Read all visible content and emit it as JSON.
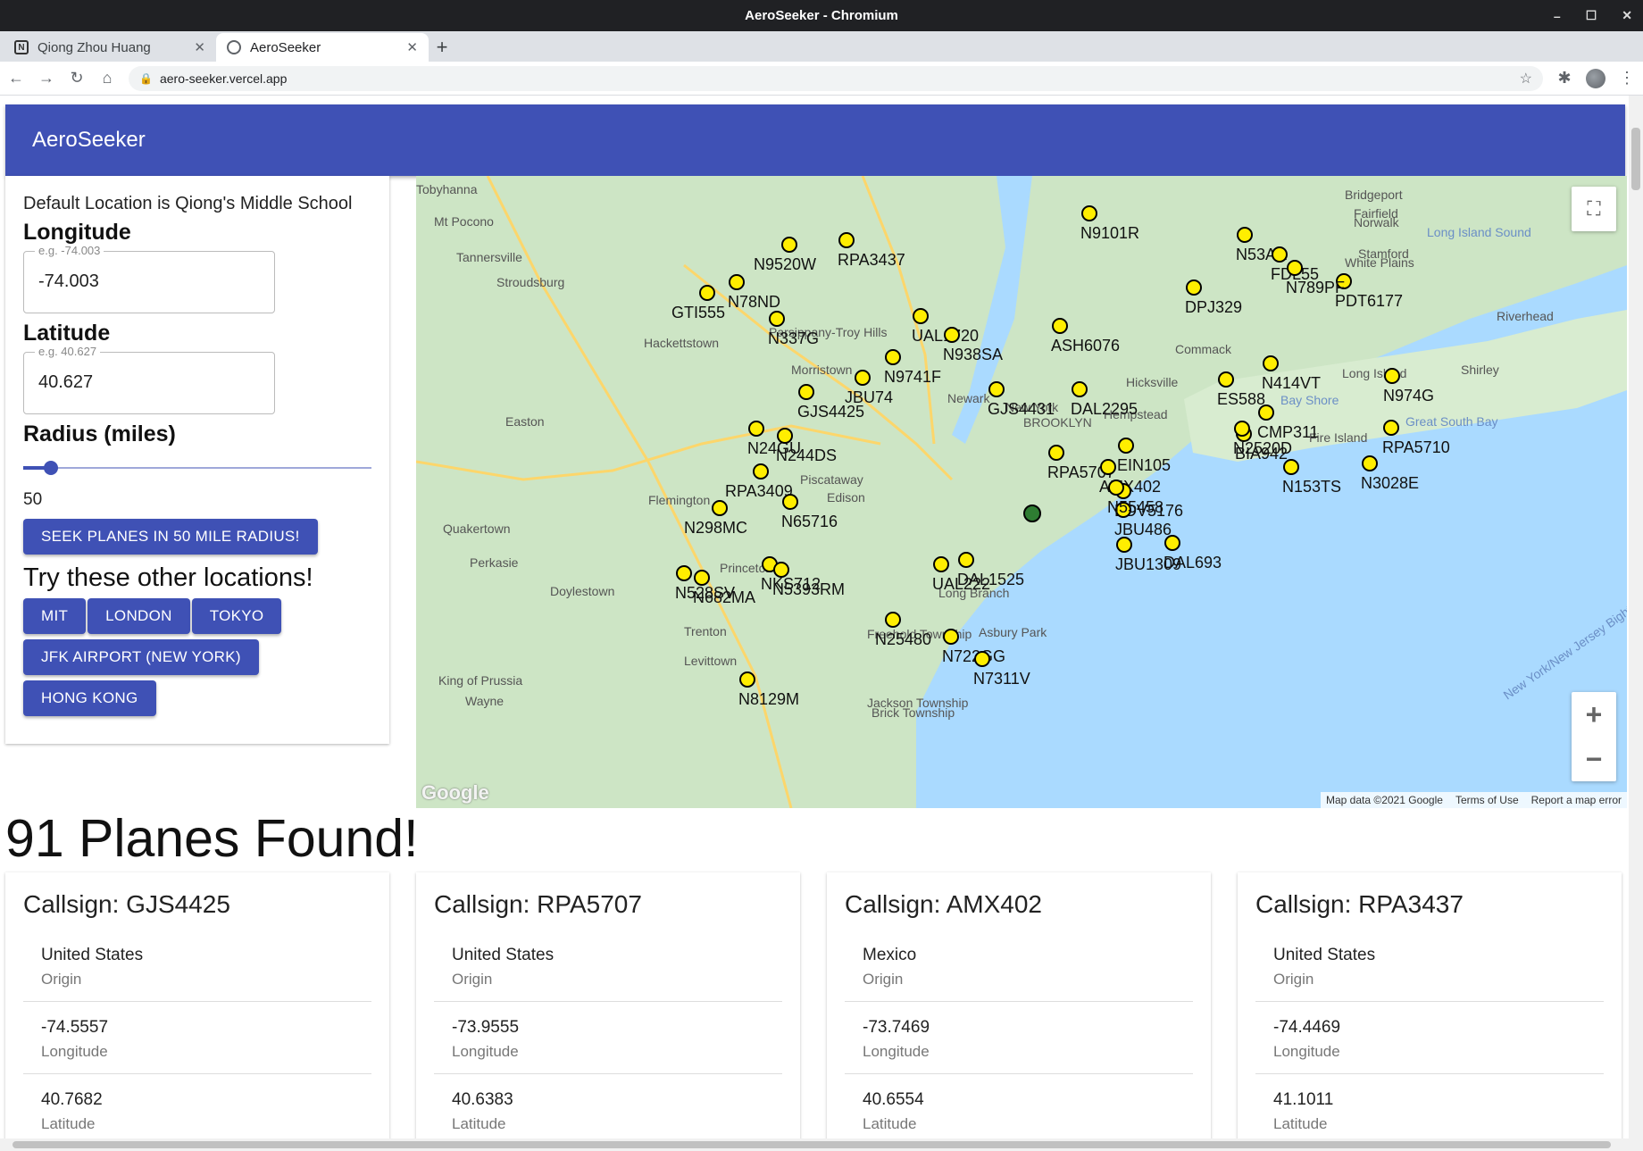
{
  "window": {
    "title": "AeroSeeker - Chromium",
    "min": "–",
    "max": "☐",
    "close": "✕"
  },
  "tabs": [
    {
      "title": "Qiong Zhou Huang",
      "favicon": "N",
      "active": false
    },
    {
      "title": "AeroSeeker",
      "favicon": "",
      "active": true
    }
  ],
  "newtab": "+",
  "tabclose": "✕",
  "omnibox": {
    "url": "aero-seeker.vercel.app"
  },
  "app": {
    "title": "AeroSeeker",
    "default_note": "Default Location is Qiong's Middle School",
    "longitude_heading": "Longitude",
    "longitude_placeholder": "e.g. -74.003",
    "longitude_value": "-74.003",
    "latitude_heading": "Latitude",
    "latitude_placeholder": "e.g. 40.627",
    "latitude_value": "40.627",
    "radius_heading": "Radius (miles)",
    "radius_value": "50",
    "radius_fraction": 0.08,
    "seek_button": "SEEK PLANES IN 50 MILE RADIUS!",
    "try_heading": "Try these other locations!",
    "locations": [
      "MIT",
      "LONDON",
      "TOKYO",
      "JFK AIRPORT (NEW YORK)",
      "HONG KONG"
    ],
    "found_text": "91 Planes Found!"
  },
  "map": {
    "attribution": [
      "Map data ©2021 Google",
      "Terms of Use",
      "Report a map error"
    ],
    "google_logo": "Google",
    "zoom_in": "+",
    "zoom_out": "−",
    "fullscreen": "⛶",
    "marker_color": "#ffee00",
    "center_marker_color": "#2e7d32",
    "planes": [
      "N9101R",
      "N53AA",
      "N9520W",
      "RPA3437",
      "N78ND",
      "GTI555",
      "N337G",
      "UAL1720",
      "N938SA",
      "N9741F",
      "JBU74",
      "GJS4425",
      "GJS4431",
      "N24GU",
      "N244DS",
      "RPA3409",
      "N65716",
      "N298MC",
      "NKS712",
      "N5393RM",
      "N682MA",
      "N528SV",
      "N25480",
      "N722GG",
      "N7311V",
      "N8129M",
      "UAL222",
      "DAL1525",
      "RPA5707",
      "AMX402",
      "EDV5176",
      "JBU486",
      "N55458",
      "JBU1309",
      "DAL693",
      "DAL2295",
      "ASH6076",
      "EIN105",
      "BIA942",
      "N153TS",
      "N3028E",
      "RPA5710",
      "PDT6177",
      "FDL55",
      "DPJ329",
      "N789PF",
      "ES588",
      "CMP311",
      "N2520D",
      "N414VT",
      "N974G"
    ],
    "place_labels": [
      "Tobyhanna",
      "Mt Pocono",
      "Tannersville",
      "Stroudsburg",
      "Hackettstown",
      "Parsippany-Troy Hills",
      "Morristown",
      "Easton",
      "Flemington",
      "Quakertown",
      "Perkasie",
      "Doylestown",
      "Trenton",
      "Levittown",
      "King of Prussia",
      "Wayne",
      "Piscataway",
      "Edison",
      "Princeton",
      "Freehold Township",
      "Jackson Township",
      "Brick Township",
      "Asbury Park",
      "Long Branch",
      "New York",
      "Newark",
      "BROOKLYN",
      "Hempstead",
      "Hicksville",
      "Commack",
      "Long Island",
      "Shirley",
      "Riverhead",
      "Bay Shore",
      "Fire Island",
      "Bridgeport",
      "Fairfield",
      "Norwalk",
      "Stamford",
      "White Plains",
      "Long Island Sound",
      "Great South Bay",
      "New York/New Jersey Bight"
    ]
  },
  "cards": [
    {
      "callsign": "Callsign: GJS4425",
      "origin": "United States",
      "longitude": "-74.5557",
      "latitude": "40.7682"
    },
    {
      "callsign": "Callsign: RPA5707",
      "origin": "United States",
      "longitude": "-73.9555",
      "latitude": "40.6383"
    },
    {
      "callsign": "Callsign: AMX402",
      "origin": "Mexico",
      "longitude": "-73.7469",
      "latitude": "40.6554"
    },
    {
      "callsign": "Callsign: RPA3437",
      "origin": "United States",
      "longitude": "-74.4469",
      "latitude": "41.1011"
    }
  ],
  "labels": {
    "origin": "Origin",
    "longitude": "Longitude",
    "latitude": "Latitude"
  }
}
